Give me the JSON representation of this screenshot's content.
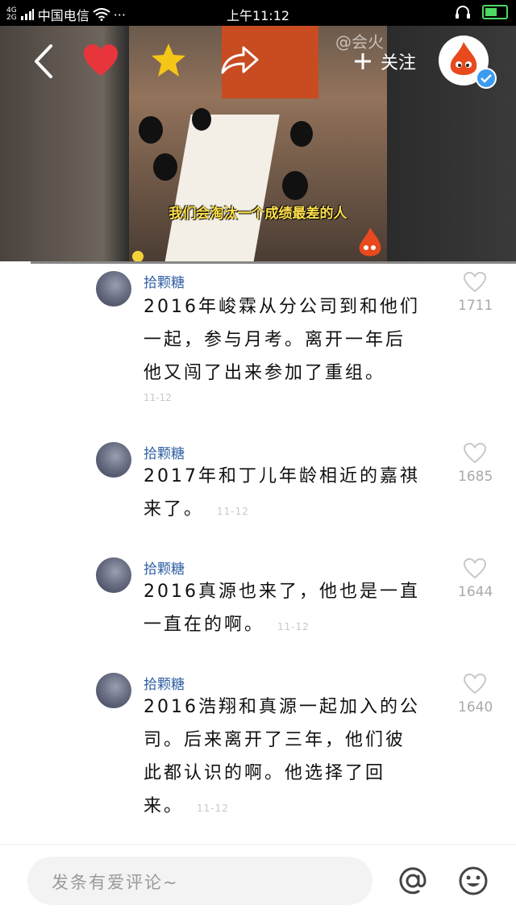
{
  "status_bar": {
    "network_top": "4G",
    "network_bottom": "2G",
    "carrier": "中国电信",
    "more": "···",
    "time": "上午11:12",
    "battery_level": 0.7
  },
  "video": {
    "subtitle": "我们会淘汰一个成绩最差的人",
    "watermark": "@会火",
    "follow_label": "关注",
    "progress": 0.06
  },
  "comments": [
    {
      "user": "拾颗糖",
      "lines": [
        "2016年峻霖从分公司到和他们",
        "一起，参与月考。离开一年后",
        "他又闯了出来参加了重组。"
      ],
      "time": "11-12",
      "likes": "1711"
    },
    {
      "user": "拾颗糖",
      "lines": [
        "2017年和丁儿年龄相近的嘉祺",
        "来了。"
      ],
      "time": "11-12",
      "likes": "1685"
    },
    {
      "user": "拾颗糖",
      "lines": [
        "2016真源也来了，他也是一直",
        "一直在的啊。"
      ],
      "time": "11-12",
      "likes": "1644"
    },
    {
      "user": "拾颗糖",
      "lines": [
        "2016浩翔和真源一起加入的公",
        "司。后来离开了三年，他们彼",
        "此都认识的啊。他选择了回",
        "来。"
      ],
      "time": "11-12",
      "likes": "1640"
    }
  ],
  "comment_input": {
    "placeholder": "发条有爱评论~"
  },
  "colors": {
    "username": "#2f5fa3",
    "like_heart": "#e8353c",
    "star": "#f5c518",
    "verified": "#3a9bf0"
  }
}
